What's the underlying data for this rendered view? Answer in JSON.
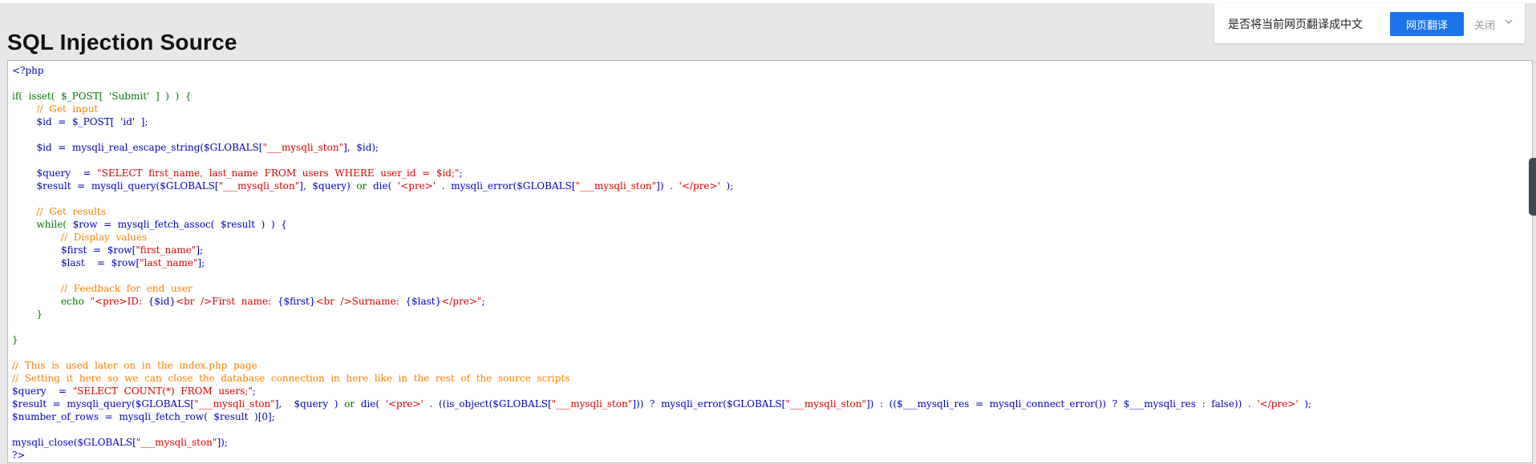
{
  "page": {
    "title": "SQL Injection Source"
  },
  "translate_bar": {
    "prompt": "是否将当前网页翻译成中文",
    "button": "网页翻译",
    "close": "关闭",
    "chevron_icon": "chevron-down-icon"
  },
  "colors": {
    "default": "#0000bb",
    "keyword": "#007700",
    "string": "#dd0000",
    "comment": "#ff8000",
    "button": "#1a73e8"
  },
  "code_lines": [
    [
      [
        "default",
        "<?php"
      ]
    ],
    [],
    [
      [
        "keyword",
        "if(  isset(  $_POST[  'Submit'  ]  )  )  {"
      ]
    ],
    [
      [
        "comment",
        "        //  Get  input"
      ]
    ],
    [
      [
        "default",
        "        $id  =  $_POST[  'id'  ];"
      ]
    ],
    [],
    [
      [
        "default",
        "        $id  =  mysqli_real_escape_string($GLOBALS["
      ],
      [
        "string",
        "\"___mysqli_ston\""
      ],
      [
        "default",
        "],  $id);"
      ]
    ],
    [],
    [
      [
        "default",
        "        $query    =  "
      ],
      [
        "string",
        "\"SELECT  first_name,  last_name  FROM  users  WHERE  user_id  =  $id;\""
      ],
      [
        "default",
        ";"
      ]
    ],
    [
      [
        "default",
        "        $result  =  mysqli_query($GLOBALS["
      ],
      [
        "string",
        "\"___mysqli_ston\""
      ],
      [
        "default",
        "],  $query)  "
      ],
      [
        "keyword",
        "or"
      ],
      [
        "default",
        "  die(  "
      ],
      [
        "string",
        "'<pre>'"
      ],
      [
        "default",
        "  .  mysqli_error($GLOBALS["
      ],
      [
        "string",
        "\"___mysqli_ston\""
      ],
      [
        "default",
        "])  .  "
      ],
      [
        "string",
        "'</pre>'"
      ],
      [
        "default",
        "  );"
      ]
    ],
    [],
    [
      [
        "comment",
        "        //  Get  results"
      ]
    ],
    [
      [
        "keyword",
        "        while(  "
      ],
      [
        "default",
        "$row  =  mysqli_fetch_assoc(  $result  )  )  {"
      ]
    ],
    [
      [
        "comment",
        "                //  Display  values"
      ]
    ],
    [
      [
        "default",
        "                $first  =  $row["
      ],
      [
        "string",
        "\"first_name\""
      ],
      [
        "default",
        "];"
      ]
    ],
    [
      [
        "default",
        "                $last    =  $row["
      ],
      [
        "string",
        "\"last_name\""
      ],
      [
        "default",
        "];"
      ]
    ],
    [],
    [
      [
        "comment",
        "                //  Feedback  for  end  user"
      ]
    ],
    [
      [
        "keyword",
        "                echo  "
      ],
      [
        "string",
        "\"<pre>ID:  "
      ],
      [
        "default",
        "{$id}"
      ],
      [
        "string",
        "<br  />First  name:  "
      ],
      [
        "default",
        "{$first}"
      ],
      [
        "string",
        "<br  />Surname:  "
      ],
      [
        "default",
        "{$last}"
      ],
      [
        "string",
        "</pre>\""
      ],
      [
        "default",
        ";"
      ]
    ],
    [
      [
        "keyword",
        "        }"
      ]
    ],
    [],
    [
      [
        "keyword",
        "}"
      ]
    ],
    [],
    [
      [
        "comment",
        "//  This  is  used  later  on  in  the  index.php  page"
      ]
    ],
    [
      [
        "comment",
        "//  Setting  it  here  so  we  can  close  the  database  connection  in  here  like  in  the  rest  of  the  source  scripts"
      ]
    ],
    [
      [
        "default",
        "$query    =  "
      ],
      [
        "string",
        "\"SELECT  COUNT(*)  FROM  users;\""
      ],
      [
        "default",
        ";"
      ]
    ],
    [
      [
        "default",
        "$result  =  mysqli_query($GLOBALS["
      ],
      [
        "string",
        "\"___mysqli_ston\""
      ],
      [
        "default",
        "],    $query  )  "
      ],
      [
        "keyword",
        "or"
      ],
      [
        "default",
        "  die(  "
      ],
      [
        "string",
        "'<pre>'"
      ],
      [
        "default",
        "  .  ((is_object($GLOBALS["
      ],
      [
        "string",
        "\"___mysqli_ston\""
      ],
      [
        "default",
        "]))  ?  mysqli_error($GLOBALS["
      ],
      [
        "string",
        "\"___mysqli_ston\""
      ],
      [
        "default",
        "])  :  (($___mysqli_res  =  mysqli_connect_error())  ?  $___mysqli_res  :  false))  .  "
      ],
      [
        "string",
        "'</pre>'"
      ],
      [
        "default",
        "  );"
      ]
    ],
    [
      [
        "default",
        "$number_of_rows  =  mysqli_fetch_row(  $result  )[0];"
      ]
    ],
    [],
    [
      [
        "default",
        "mysqli_close($GLOBALS["
      ],
      [
        "string",
        "\"___mysqli_ston\""
      ],
      [
        "default",
        "]);"
      ]
    ],
    [
      [
        "default",
        "?>"
      ]
    ]
  ]
}
